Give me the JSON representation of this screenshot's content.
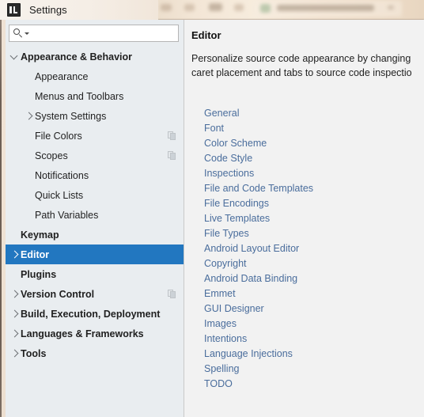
{
  "window": {
    "title": "Settings",
    "app_icon": "intellij-idea-logo-icon"
  },
  "search": {
    "value": "",
    "placeholder": "",
    "icon": "search-icon",
    "dropdown_icon": "chevron-down-icon"
  },
  "sidebar": {
    "items": [
      {
        "label": "Appearance & Behavior",
        "level": 0,
        "bold": true,
        "chevron": "down",
        "selected": false,
        "copy_icon": false
      },
      {
        "label": "Appearance",
        "level": 1,
        "bold": false,
        "chevron": "none",
        "selected": false,
        "copy_icon": false
      },
      {
        "label": "Menus and Toolbars",
        "level": 1,
        "bold": false,
        "chevron": "none",
        "selected": false,
        "copy_icon": false
      },
      {
        "label": "System Settings",
        "level": 1,
        "bold": false,
        "chevron": "right",
        "selected": false,
        "copy_icon": false
      },
      {
        "label": "File Colors",
        "level": 1,
        "bold": false,
        "chevron": "none",
        "selected": false,
        "copy_icon": true
      },
      {
        "label": "Scopes",
        "level": 1,
        "bold": false,
        "chevron": "none",
        "selected": false,
        "copy_icon": true
      },
      {
        "label": "Notifications",
        "level": 1,
        "bold": false,
        "chevron": "none",
        "selected": false,
        "copy_icon": false
      },
      {
        "label": "Quick Lists",
        "level": 1,
        "bold": false,
        "chevron": "none",
        "selected": false,
        "copy_icon": false
      },
      {
        "label": "Path Variables",
        "level": 1,
        "bold": false,
        "chevron": "none",
        "selected": false,
        "copy_icon": false
      },
      {
        "label": "Keymap",
        "level": 0,
        "bold": true,
        "chevron": "none",
        "selected": false,
        "copy_icon": false
      },
      {
        "label": "Editor",
        "level": 0,
        "bold": true,
        "chevron": "right",
        "selected": true,
        "copy_icon": false
      },
      {
        "label": "Plugins",
        "level": 0,
        "bold": true,
        "chevron": "none",
        "selected": false,
        "copy_icon": false
      },
      {
        "label": "Version Control",
        "level": 0,
        "bold": true,
        "chevron": "right",
        "selected": false,
        "copy_icon": true
      },
      {
        "label": "Build, Execution, Deployment",
        "level": 0,
        "bold": true,
        "chevron": "right",
        "selected": false,
        "copy_icon": false
      },
      {
        "label": "Languages & Frameworks",
        "level": 0,
        "bold": true,
        "chevron": "right",
        "selected": false,
        "copy_icon": false
      },
      {
        "label": "Tools",
        "level": 0,
        "bold": true,
        "chevron": "right",
        "selected": false,
        "copy_icon": false
      }
    ]
  },
  "main": {
    "title": "Editor",
    "description": "Personalize source code appearance by changing\ncaret placement and tabs to source code inspectio",
    "links": [
      "General",
      "Font",
      "Color Scheme",
      "Code Style",
      "Inspections",
      "File and Code Templates",
      "File Encodings",
      "Live Templates",
      "File Types",
      "Android Layout Editor",
      "Copyright",
      "Android Data Binding",
      "Emmet",
      "GUI Designer",
      "Images",
      "Intentions",
      "Language Injections",
      "Spelling",
      "TODO"
    ]
  },
  "colors": {
    "selection_blue": "#2277c0",
    "link_blue": "#4a6d9c",
    "sidebar_bg": "#e9edf0",
    "panel_bg": "#f2f2f2"
  }
}
